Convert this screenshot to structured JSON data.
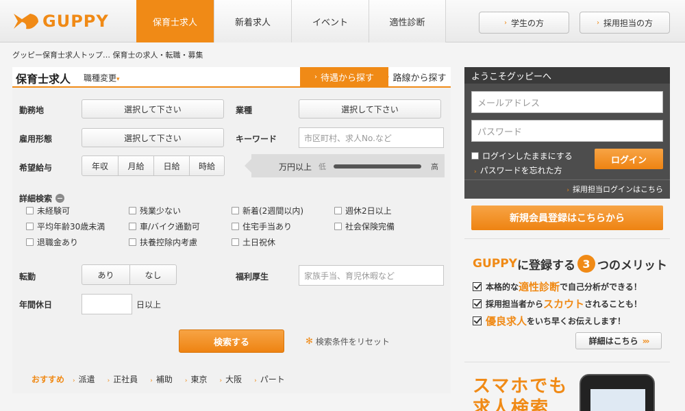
{
  "header": {
    "logo_text": "GUPPY",
    "nav": [
      {
        "label": "保育士求人",
        "active": true
      },
      {
        "label": "新着求人",
        "active": false
      },
      {
        "label": "イベント",
        "active": false
      },
      {
        "label": "適性診断",
        "active": false
      }
    ],
    "student_button": "学生の方",
    "employer_button": "採用担当の方"
  },
  "breadcrumb": "グッピー保育士求人トップ… 保育士の求人・転職・募集",
  "search": {
    "title": "保育士求人",
    "job_change": "職種変更",
    "tab_treatment": "待遇から探す",
    "tab_route": "路線から探す",
    "labels": {
      "location": "勤務地",
      "business": "業種",
      "employment": "雇用形態",
      "keyword": "キーワード",
      "salary": "希望給与",
      "detail": "詳細検索",
      "transfer": "転勤",
      "welfare": "福利厚生",
      "holidays": "年間休日"
    },
    "select_placeholder": "選択して下さい",
    "keyword_placeholder": "市区町村、求人No.など",
    "salary_options": [
      "年収",
      "月給",
      "日給",
      "時給"
    ],
    "salary_unit": "万円以上",
    "salary_low": "低",
    "salary_high": "高",
    "checkboxes": [
      "未経験可",
      "残業少ない",
      "新着(2週間以内)",
      "週休2日以上",
      "平均年齢30歳未満",
      "車/バイク通勤可",
      "住宅手当あり",
      "社会保険完備",
      "退職金あり",
      "扶養控除内考慮",
      "土日祝休"
    ],
    "transfer_options": [
      "あり",
      "なし"
    ],
    "welfare_placeholder": "家族手当、育児休暇など",
    "holidays_value": "",
    "holidays_suffix": "日以上",
    "search_button": "検索する",
    "reset_label": "検索条件をリセット",
    "recommend_label": "おすすめ",
    "recommend_items": [
      "派遣",
      "正社員",
      "補助",
      "東京",
      "大阪",
      "パート"
    ]
  },
  "login": {
    "welcome": "ようこそグッピーへ",
    "email_placeholder": "メールアドレス",
    "password_placeholder": "パスワード",
    "keep_logged_in": "ログインしたままにする",
    "login_button": "ログイン",
    "forgot_password": "パスワードを忘れた方",
    "employer_login": "採用担当ログインはこちら"
  },
  "register_button": "新規会員登録はこちらから",
  "merit": {
    "brand": "GUPPY",
    "title_mid": "に登録する",
    "number": "3",
    "title_end": "つのメリット",
    "items": [
      {
        "pre": "本格的な",
        "hl": "適性診断",
        "post": "で自己分析ができる！"
      },
      {
        "pre": "採用担当者から",
        "hl": "スカウト",
        "post": "されることも！"
      },
      {
        "pre": "",
        "hl": "優良求人",
        "post": "をいち早くお伝えします！"
      }
    ],
    "detail_button": "詳細はこちら"
  },
  "promo": {
    "line1": "スマホでも",
    "line2": "求人検索"
  }
}
